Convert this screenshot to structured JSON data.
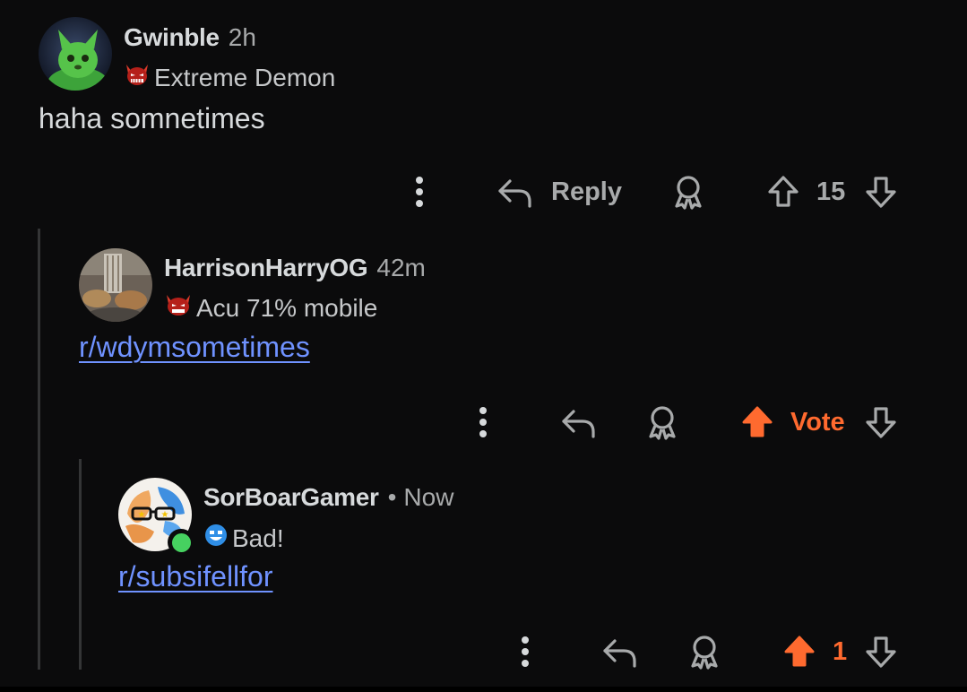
{
  "comments": [
    {
      "username": "Gwinble",
      "time": "2h",
      "flair": "Extreme Demon",
      "body": "haha somnetimes",
      "reply_label": "Reply",
      "vote_count": "15"
    },
    {
      "username": "HarrisonHarryOG",
      "time": "42m",
      "flair": "Acu 71% mobile",
      "body_link": "r/wdymsometimes",
      "vote_label": "Vote"
    },
    {
      "username": "SorBoarGamer",
      "separator": "•",
      "time": "Now",
      "flair": "Bad!",
      "body_link": "r/subsifellfor",
      "vote_count": "1"
    }
  ],
  "colors": {
    "background": "#0b0b0c",
    "text": "#d7dadc",
    "muted": "#a8aaab",
    "link": "#6f92ff",
    "upvote": "#ff6a2f",
    "online": "#46d160",
    "thread_line": "#343536"
  },
  "icons": [
    "more-vertical-icon",
    "reply-arrow-icon",
    "award-icon",
    "upvote-arrow-icon",
    "downvote-arrow-icon",
    "demon-face-icon",
    "smiley-icon"
  ]
}
